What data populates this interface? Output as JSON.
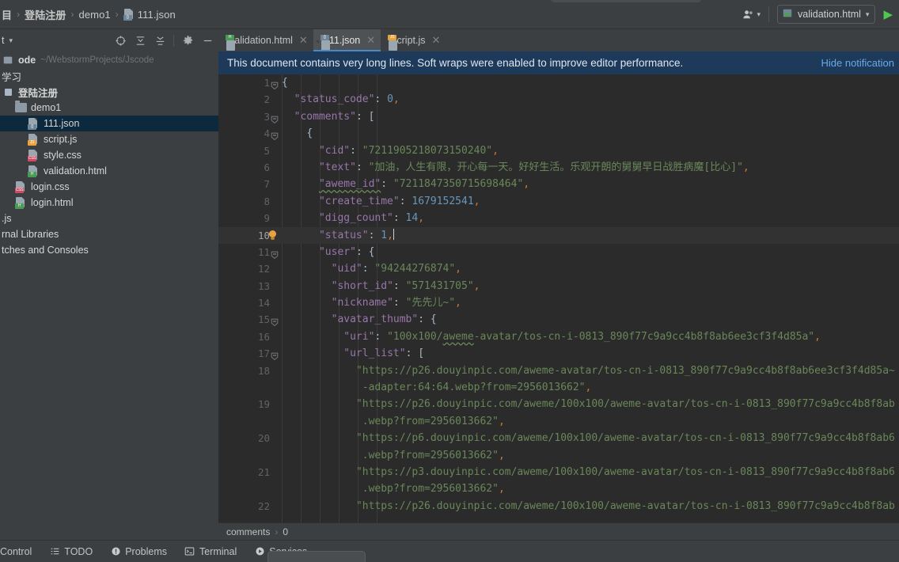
{
  "window": {
    "breadcrumb": [
      {
        "label": "目",
        "icon": "",
        "cjk": true
      },
      {
        "label": "登陆注册",
        "icon": "",
        "cjk": true
      },
      {
        "label": "demo1",
        "icon": "",
        "cjk": false
      },
      {
        "label": "111.json",
        "icon": "json-file-icon",
        "cjk": false
      }
    ],
    "people_icon": "people-icon",
    "run_config": {
      "label": "validation.html",
      "icon": "html-file-icon",
      "dropdown": "▾"
    },
    "run_button": "▶"
  },
  "project_panel": {
    "title": "t",
    "title_caret": "▾",
    "tools": [
      "locate-icon",
      "expand-all-icon",
      "collapse-all-icon",
      "settings-gear-icon",
      "hide-panel-icon"
    ],
    "tree": [
      {
        "indent": 0,
        "label": "ode",
        "note": "~/WebstormProjects/Jscode",
        "icon": "project-root-icon",
        "bold": true,
        "selected": false
      },
      {
        "indent": 0,
        "label": "学习",
        "note": "",
        "icon": "none",
        "bold": false,
        "selected": false
      },
      {
        "indent": 0,
        "label": "登陆注册",
        "note": "",
        "icon": "module-icon",
        "bold": true,
        "selected": false
      },
      {
        "indent": 1,
        "label": "demo1",
        "note": "",
        "icon": "folder-icon",
        "bold": false,
        "selected": false
      },
      {
        "indent": 2,
        "label": "111.json",
        "note": "",
        "icon": "json-file-icon",
        "bold": false,
        "selected": true
      },
      {
        "indent": 2,
        "label": "script.js",
        "note": "",
        "icon": "js-file-icon",
        "bold": false,
        "selected": false
      },
      {
        "indent": 2,
        "label": "style.css",
        "note": "",
        "icon": "css-file-icon",
        "bold": false,
        "selected": false
      },
      {
        "indent": 2,
        "label": "validation.html",
        "note": "",
        "icon": "html-file-icon",
        "bold": false,
        "selected": false
      },
      {
        "indent": 1,
        "label": "login.css",
        "note": "",
        "icon": "css-file-icon",
        "bold": false,
        "selected": false
      },
      {
        "indent": 1,
        "label": "login.html",
        "note": "",
        "icon": "html-file-icon",
        "bold": false,
        "selected": false
      },
      {
        "indent": 0,
        "label": ".js",
        "note": "",
        "icon": "none",
        "bold": false,
        "selected": false
      },
      {
        "indent": 0,
        "label": "rnal Libraries",
        "note": "",
        "icon": "none",
        "bold": false,
        "selected": false
      },
      {
        "indent": 0,
        "label": "tches and Consoles",
        "note": "",
        "icon": "none",
        "bold": false,
        "selected": false
      }
    ]
  },
  "editor": {
    "tabs": [
      {
        "label": "validation.html",
        "icon": "html-file-icon",
        "active": false,
        "close": "✕"
      },
      {
        "label": "111.json",
        "icon": "json-file-icon",
        "active": true,
        "close": "✕"
      },
      {
        "label": "script.js",
        "icon": "js-file-icon",
        "active": false,
        "close": "✕"
      }
    ],
    "notification": {
      "message": "This document contains very long lines. Soft wraps were enabled to improve editor performance.",
      "action": "Hide notification"
    },
    "breadcrumb": {
      "first": "comments",
      "sep": "›",
      "second": "0"
    },
    "current_line": 10,
    "lines": [
      {
        "num": "1",
        "fold": true,
        "bulb": false,
        "indent": 0,
        "tokens": [
          {
            "t": "{",
            "c": "b"
          }
        ]
      },
      {
        "num": "2",
        "fold": false,
        "bulb": false,
        "indent": 1,
        "tokens": [
          {
            "t": "\"status_code\"",
            "c": "k"
          },
          {
            "t": ": ",
            "c": "q"
          },
          {
            "t": "0",
            "c": "n"
          },
          {
            "t": ",",
            "c": "p"
          }
        ]
      },
      {
        "num": "3",
        "fold": true,
        "bulb": false,
        "indent": 1,
        "tokens": [
          {
            "t": "\"comments\"",
            "c": "k"
          },
          {
            "t": ": ",
            "c": "q"
          },
          {
            "t": "[",
            "c": "b"
          }
        ]
      },
      {
        "num": "4",
        "fold": true,
        "bulb": false,
        "indent": 2,
        "tokens": [
          {
            "t": "{",
            "c": "b"
          }
        ]
      },
      {
        "num": "5",
        "fold": false,
        "bulb": false,
        "indent": 3,
        "tokens": [
          {
            "t": "\"cid\"",
            "c": "k"
          },
          {
            "t": ": ",
            "c": "q"
          },
          {
            "t": "\"7211905218073150240\"",
            "c": "s"
          },
          {
            "t": ",",
            "c": "p"
          }
        ]
      },
      {
        "num": "6",
        "fold": false,
        "bulb": false,
        "indent": 3,
        "tokens": [
          {
            "t": "\"text\"",
            "c": "k"
          },
          {
            "t": ": ",
            "c": "q"
          },
          {
            "t": "\"加油，人生有限，开心每一天。好好生活。乐观开朗的舅舅早日战胜病魔[比心]\"",
            "c": "s"
          },
          {
            "t": ",",
            "c": "p"
          }
        ]
      },
      {
        "num": "7",
        "fold": false,
        "bulb": false,
        "indent": 3,
        "tokens": [
          {
            "t": "\"aweme_id\"",
            "c": "k u"
          },
          {
            "t": ": ",
            "c": "q"
          },
          {
            "t": "\"7211847350715698464\"",
            "c": "s"
          },
          {
            "t": ",",
            "c": "p"
          }
        ]
      },
      {
        "num": "8",
        "fold": false,
        "bulb": false,
        "indent": 3,
        "tokens": [
          {
            "t": "\"create_time\"",
            "c": "k"
          },
          {
            "t": ": ",
            "c": "q"
          },
          {
            "t": "1679152541",
            "c": "n"
          },
          {
            "t": ",",
            "c": "p"
          }
        ]
      },
      {
        "num": "9",
        "fold": false,
        "bulb": false,
        "indent": 3,
        "tokens": [
          {
            "t": "\"digg_count\"",
            "c": "k"
          },
          {
            "t": ": ",
            "c": "q"
          },
          {
            "t": "14",
            "c": "n"
          },
          {
            "t": ",",
            "c": "p"
          }
        ]
      },
      {
        "num": "10",
        "fold": false,
        "bulb": true,
        "indent": 3,
        "tokens": [
          {
            "t": "\"status\"",
            "c": "k"
          },
          {
            "t": ": ",
            "c": "q"
          },
          {
            "t": "1",
            "c": "n"
          },
          {
            "t": ",",
            "c": "p"
          },
          {
            "t": "|",
            "c": "cursor"
          }
        ]
      },
      {
        "num": "11",
        "fold": true,
        "bulb": false,
        "indent": 3,
        "tokens": [
          {
            "t": "\"user\"",
            "c": "k"
          },
          {
            "t": ": ",
            "c": "q"
          },
          {
            "t": "{",
            "c": "b"
          }
        ]
      },
      {
        "num": "12",
        "fold": false,
        "bulb": false,
        "indent": 4,
        "tokens": [
          {
            "t": "\"uid\"",
            "c": "k"
          },
          {
            "t": ": ",
            "c": "q"
          },
          {
            "t": "\"94244276874\"",
            "c": "s"
          },
          {
            "t": ",",
            "c": "p"
          }
        ]
      },
      {
        "num": "13",
        "fold": false,
        "bulb": false,
        "indent": 4,
        "tokens": [
          {
            "t": "\"short_id\"",
            "c": "k"
          },
          {
            "t": ": ",
            "c": "q"
          },
          {
            "t": "\"571431705\"",
            "c": "s"
          },
          {
            "t": ",",
            "c": "p"
          }
        ]
      },
      {
        "num": "14",
        "fold": false,
        "bulb": false,
        "indent": 4,
        "tokens": [
          {
            "t": "\"nickname\"",
            "c": "k"
          },
          {
            "t": ": ",
            "c": "q"
          },
          {
            "t": "\"先先儿~\"",
            "c": "s"
          },
          {
            "t": ",",
            "c": "p"
          }
        ]
      },
      {
        "num": "15",
        "fold": true,
        "bulb": false,
        "indent": 4,
        "tokens": [
          {
            "t": "\"avatar_thumb\"",
            "c": "k"
          },
          {
            "t": ": ",
            "c": "q"
          },
          {
            "t": "{",
            "c": "b"
          }
        ]
      },
      {
        "num": "16",
        "fold": false,
        "bulb": false,
        "indent": 5,
        "tokens": [
          {
            "t": "\"uri\"",
            "c": "k"
          },
          {
            "t": ": ",
            "c": "q"
          },
          {
            "t": "\"100x100/",
            "c": "s"
          },
          {
            "t": "aweme",
            "c": "s u"
          },
          {
            "t": "-avatar/tos-cn-i-0813_890f77c9a9cc4b8f8ab6ee3cf3f4d85a\"",
            "c": "s"
          },
          {
            "t": ",",
            "c": "p"
          }
        ]
      },
      {
        "num": "17",
        "fold": true,
        "bulb": false,
        "indent": 5,
        "tokens": [
          {
            "t": "\"url_list\"",
            "c": "k"
          },
          {
            "t": ": ",
            "c": "q"
          },
          {
            "t": "[",
            "c": "b"
          }
        ]
      },
      {
        "num": "18",
        "fold": false,
        "bulb": false,
        "indent": 6,
        "tokens": [
          {
            "t": "\"https://p26.douyinpic.com/aweme-avatar/tos-cn-i-0813_890f77c9a9cc4b8f8ab6ee3cf3f4d85a~",
            "c": "s"
          }
        ]
      },
      {
        "num": "",
        "fold": false,
        "bulb": false,
        "indent": 6,
        "wrap": true,
        "tokens": [
          {
            "t": "-adapter:64:64.webp?from=2956013662\"",
            "c": "s"
          },
          {
            "t": ",",
            "c": "p"
          }
        ]
      },
      {
        "num": "19",
        "fold": false,
        "bulb": false,
        "indent": 6,
        "tokens": [
          {
            "t": "\"https://p26.douyinpic.com/aweme/100x100/aweme-avatar/tos-cn-i-0813_890f77c9a9cc4b8f8ab",
            "c": "s"
          }
        ]
      },
      {
        "num": "",
        "fold": false,
        "bulb": false,
        "indent": 6,
        "wrap": true,
        "tokens": [
          {
            "t": ".webp?from=2956013662\"",
            "c": "s"
          },
          {
            "t": ",",
            "c": "p"
          }
        ]
      },
      {
        "num": "20",
        "fold": false,
        "bulb": false,
        "indent": 6,
        "tokens": [
          {
            "t": "\"https://p6.douyinpic.com/aweme/100x100/aweme-avatar/tos-cn-i-0813_890f77c9a9cc4b8f8ab6",
            "c": "s"
          }
        ]
      },
      {
        "num": "",
        "fold": false,
        "bulb": false,
        "indent": 6,
        "wrap": true,
        "tokens": [
          {
            "t": ".webp?from=2956013662\"",
            "c": "s"
          },
          {
            "t": ",",
            "c": "p"
          }
        ]
      },
      {
        "num": "21",
        "fold": false,
        "bulb": false,
        "indent": 6,
        "tokens": [
          {
            "t": "\"https://p3.douyinpic.com/aweme/100x100/aweme-avatar/tos-cn-i-0813_890f77c9a9cc4b8f8ab6",
            "c": "s"
          }
        ]
      },
      {
        "num": "",
        "fold": false,
        "bulb": false,
        "indent": 6,
        "wrap": true,
        "tokens": [
          {
            "t": ".webp?from=2956013662\"",
            "c": "s"
          },
          {
            "t": ",",
            "c": "p"
          }
        ]
      },
      {
        "num": "22",
        "fold": false,
        "bulb": false,
        "indent": 6,
        "tokens": [
          {
            "t": "\"https://p26.douyinpic.com/aweme/100x100/aweme-avatar/tos-cn-i-0813_890f77c9a9cc4b8f8ab",
            "c": "s"
          }
        ]
      }
    ]
  },
  "status_bar": {
    "items": [
      {
        "label": "Control",
        "icon": "none"
      },
      {
        "label": "TODO",
        "icon": "todo-icon"
      },
      {
        "label": "Problems",
        "icon": "problems-icon"
      },
      {
        "label": "Terminal",
        "icon": "terminal-icon"
      },
      {
        "label": "Services",
        "icon": "services-icon"
      }
    ]
  },
  "colors": {
    "panel_bg": "#3c3f41",
    "editor_bg": "#2b2b2b",
    "selection": "#0d293e",
    "notification_bg": "#1e3a5a",
    "accent_blue": "#4a88c7",
    "link_blue": "#6aa8e8",
    "string_green": "#6a8759",
    "key_purple": "#9876aa",
    "number_blue": "#6897bb",
    "comma_orange": "#cc7832",
    "run_green": "#4ec94e"
  }
}
